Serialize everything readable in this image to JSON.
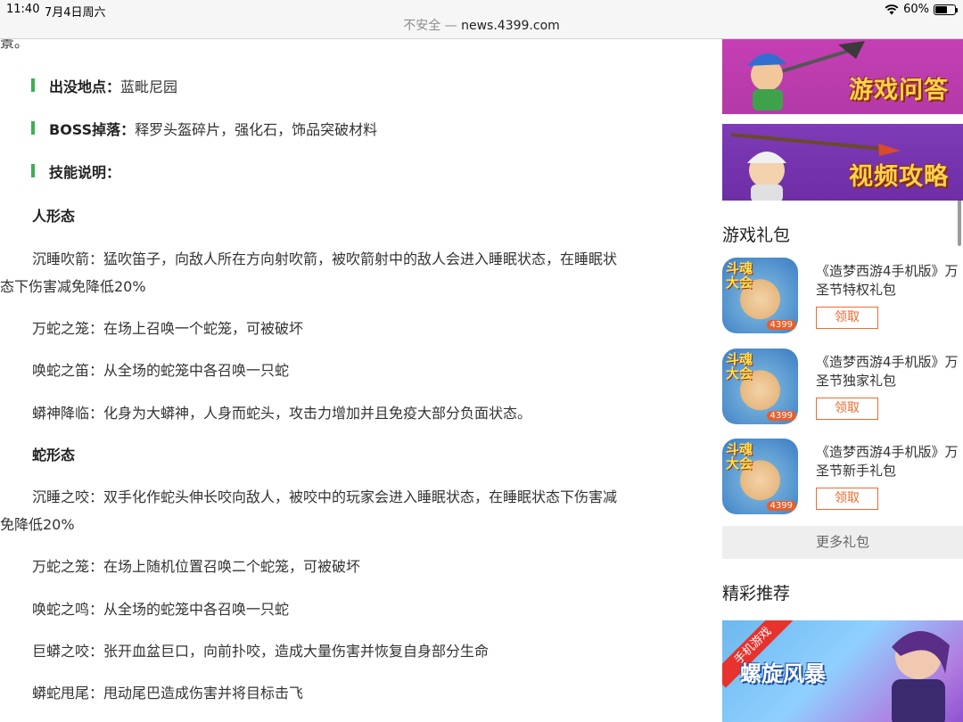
{
  "status_bar": {
    "time": "11:40",
    "date": "7月4日周六",
    "battery": "60%",
    "battery_level": 0.6
  },
  "url_bar": {
    "security": "不安全",
    "separator": " — ",
    "host": "news.4399.com"
  },
  "article": {
    "truncated_top": "景。",
    "location_label": "出没地点：",
    "location_value": "蓝毗尼园",
    "drop_label": "BOSS掉落：",
    "drop_value": "释罗头盔碎片，强化石，饰品突破材料",
    "skill_label": "技能说明：",
    "human_form_title": "人形态",
    "human_skills": [
      "沉睡吹箭：猛吹笛子，向敌人所在方向射吹箭，被吹箭射中的敌人会进入睡眠状态，在睡眠状",
      "态下伤害减免降低20%",
      "万蛇之笼：在场上召唤一个蛇笼，可被破坏",
      "唤蛇之笛：从全场的蛇笼中各召唤一只蛇",
      "蟒神降临：化身为大蟒神，人身而蛇头，攻击力增加并且免疫大部分负面状态。"
    ],
    "snake_form_title": "蛇形态",
    "snake_skills": [
      "沉睡之咬：双手化作蛇头伸长咬向敌人，被咬中的玩家会进入睡眠状态，在睡眠状态下伤害减",
      "免降低20%",
      "万蛇之笼：在场上随机位置召唤二个蛇笼，可被破坏",
      "唤蛇之鸣：从全场的蛇笼中各召唤一只蛇",
      "巨蟒之咬：张开血盆巨口，向前扑咬，造成大量伤害并恢复自身部分生命",
      "蟒蛇甩尾：甩动尾巴造成伤害并将目标击飞"
    ]
  },
  "sidebar": {
    "banners": [
      {
        "title": "游戏问答"
      },
      {
        "title": "视频攻略"
      }
    ],
    "gift_section_title": "游戏礼包",
    "gifts": [
      {
        "icon_text": "斗魂大会",
        "icon_badge": "4399",
        "name": "《造梦西游4手机版》万圣节特权礼包",
        "claim": "领取"
      },
      {
        "icon_text": "斗魂大会",
        "icon_badge": "4399",
        "name": "《造梦西游4手机版》万圣节独家礼包",
        "claim": "领取"
      },
      {
        "icon_text": "斗魂大会",
        "icon_badge": "4399",
        "name": "《造梦西游4手机版》万圣节新手礼包",
        "claim": "领取"
      }
    ],
    "more_gifts": "更多礼包",
    "recommend_title": "精彩推荐",
    "promo": {
      "ribbon": "手机游戏",
      "title": "螺旋风暴"
    }
  }
}
